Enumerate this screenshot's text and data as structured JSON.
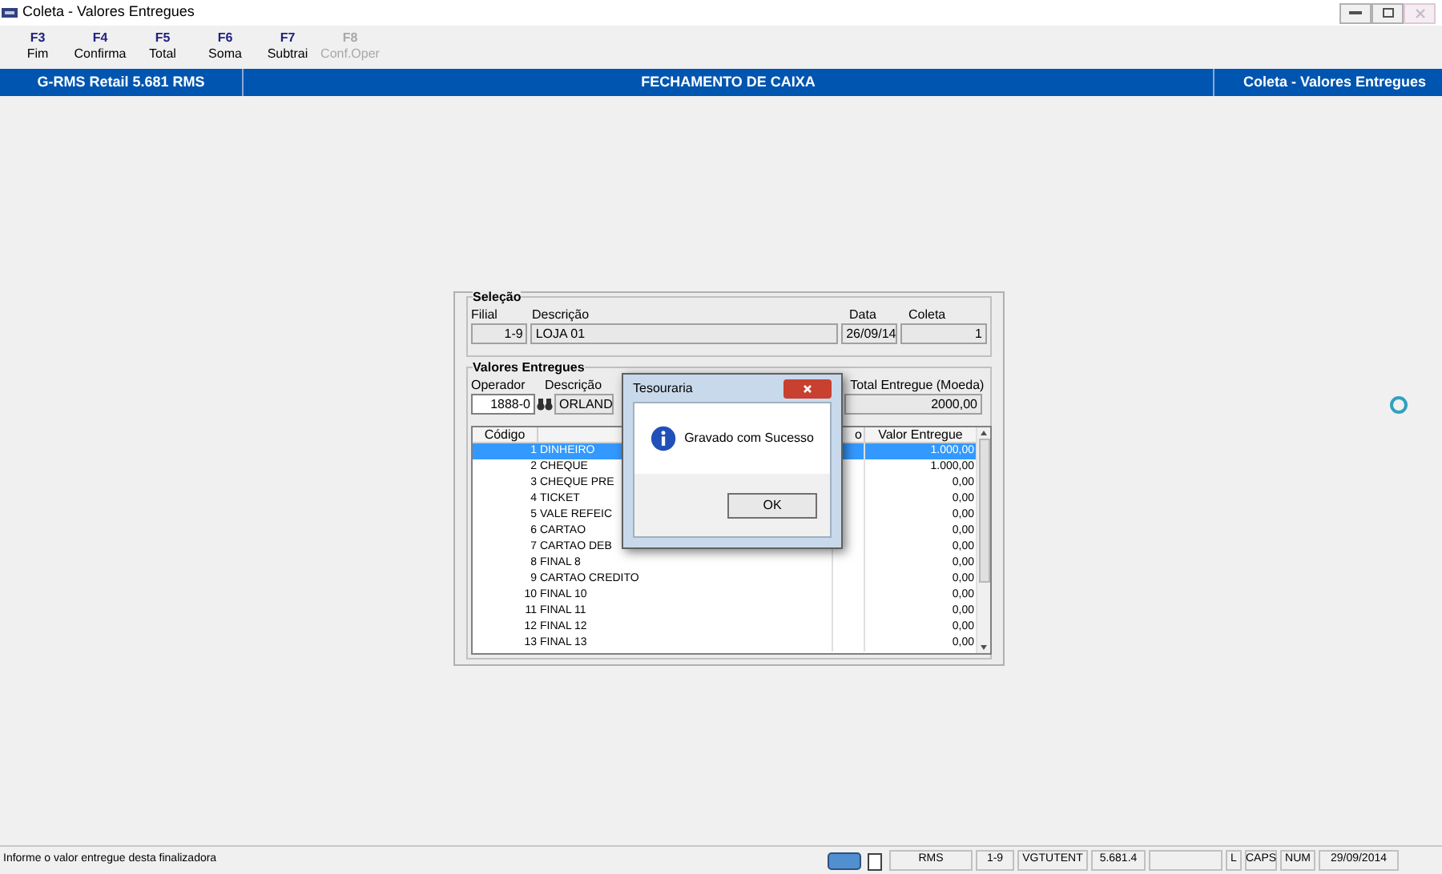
{
  "window": {
    "title": "Coleta - Valores Entregues"
  },
  "toolbar": {
    "keys": [
      {
        "key": "F3",
        "label": "Fim",
        "disabled": false
      },
      {
        "key": "F4",
        "label": "Confirma",
        "disabled": false
      },
      {
        "key": "F5",
        "label": "Total",
        "disabled": false
      },
      {
        "key": "F6",
        "label": "Soma",
        "disabled": false
      },
      {
        "key": "F7",
        "label": "Subtrai",
        "disabled": false
      },
      {
        "key": "F8",
        "label": "Conf.Oper",
        "disabled": true
      }
    ]
  },
  "header_bar": {
    "left": "G-RMS Retail 5.681 RMS",
    "center": "FECHAMENTO DE CAIXA",
    "right": "Coleta - Valores Entregues"
  },
  "selecao": {
    "title": "Seleção",
    "filial_label": "Filial",
    "descricao_label": "Descrição",
    "data_label": "Data",
    "coleta_label": "Coleta",
    "filial": "1-9",
    "descricao": "LOJA 01",
    "data": "26/09/14",
    "coleta": "1"
  },
  "valores": {
    "title": "Valores Entregues",
    "operador_label": "Operador",
    "descricao_label": "Descrição",
    "total_label": "Total Entregue (Moeda)",
    "operador": "1888-0",
    "descricao": "ORLAND",
    "total": "2000,00"
  },
  "table": {
    "columns": [
      "Código",
      "o",
      "Valor Entregue"
    ],
    "rows": [
      {
        "codigo": "1",
        "descricao": "DINHEIRO",
        "valor": "1.000,00",
        "selected": true
      },
      {
        "codigo": "2",
        "descricao": "CHEQUE",
        "valor": "1.000,00",
        "selected": false
      },
      {
        "codigo": "3",
        "descricao": "CHEQUE PRE",
        "valor": "0,00",
        "selected": false
      },
      {
        "codigo": "4",
        "descricao": "TICKET",
        "valor": "0,00",
        "selected": false
      },
      {
        "codigo": "5",
        "descricao": "VALE REFEIC",
        "valor": "0,00",
        "selected": false
      },
      {
        "codigo": "6",
        "descricao": "CARTAO",
        "valor": "0,00",
        "selected": false
      },
      {
        "codigo": "7",
        "descricao": "CARTAO DEB",
        "valor": "0,00",
        "selected": false
      },
      {
        "codigo": "8",
        "descricao": "FINAL 8",
        "valor": "0,00",
        "selected": false
      },
      {
        "codigo": "9",
        "descricao": "CARTAO CREDITO",
        "valor": "0,00",
        "selected": false
      },
      {
        "codigo": "10",
        "descricao": "FINAL 10",
        "valor": "0,00",
        "selected": false
      },
      {
        "codigo": "11",
        "descricao": "FINAL 11",
        "valor": "0,00",
        "selected": false
      },
      {
        "codigo": "12",
        "descricao": "FINAL 12",
        "valor": "0,00",
        "selected": false
      },
      {
        "codigo": "13",
        "descricao": "FINAL 13",
        "valor": "0,00",
        "selected": false
      }
    ]
  },
  "dialog": {
    "title": "Tesouraria",
    "message": "Gravado com Sucesso",
    "button": "OK"
  },
  "status_bar": {
    "message": "Informe o valor entregue desta finalizadora",
    "cells": [
      "RMS",
      "1-9",
      "VGTUTENT",
      "5.681.4",
      "L",
      "CAPS",
      "NUM",
      "29/09/2014"
    ]
  }
}
